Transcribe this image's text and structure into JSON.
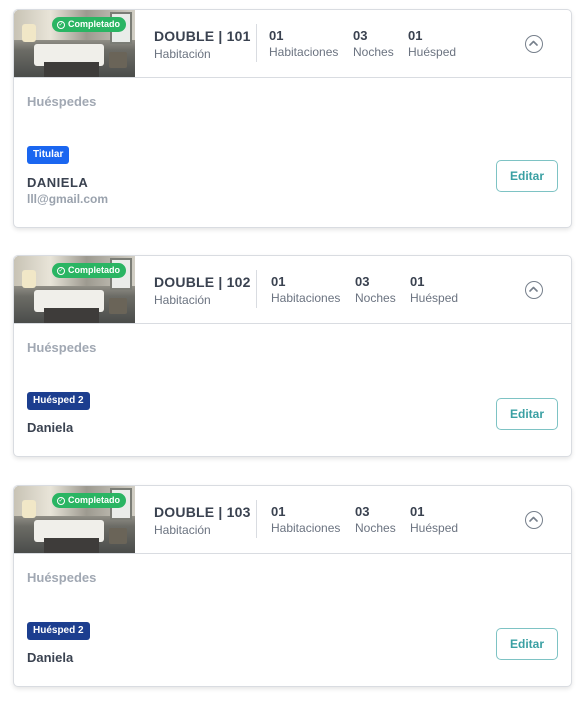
{
  "reservations": [
    {
      "status_badge": "Completado",
      "room": "DOUBLE | 101",
      "room_subtitle": "Habitación",
      "rooms_count": "01",
      "rooms_label": "Habitaciones",
      "nights_count": "03",
      "nights_label": "Noches",
      "guests_count": "01",
      "guests_label": "Huésped",
      "section_title": "Huéspedes",
      "guest_role": "Titular",
      "guest_name": "DANIELA",
      "guest_email": "lll@gmail.com",
      "edit_label": "Editar"
    },
    {
      "status_badge": "Completado",
      "room": "DOUBLE | 102",
      "room_subtitle": "Habitación",
      "rooms_count": "01",
      "rooms_label": "Habitaciones",
      "nights_count": "03",
      "nights_label": "Noches",
      "guests_count": "01",
      "guests_label": "Huésped",
      "section_title": "Huéspedes",
      "guest_role": "Huésped 2",
      "guest_name": "Daniela",
      "edit_label": "Editar"
    },
    {
      "status_badge": "Completado",
      "room": "DOUBLE | 103",
      "room_subtitle": "Habitación",
      "rooms_count": "01",
      "rooms_label": "Habitaciones",
      "nights_count": "03",
      "nights_label": "Noches",
      "guests_count": "01",
      "guests_label": "Huésped",
      "section_title": "Huéspedes",
      "guest_role": "Huésped 2",
      "guest_name": "Daniela",
      "edit_label": "Editar"
    }
  ],
  "icons": {
    "status": "check-circle-icon",
    "collapse": "chevron-up-circle-icon",
    "thumbnail": "room-photo"
  },
  "colors": {
    "completed": "#2ab563",
    "titular": "#1a66f0",
    "guest_badge": "#1c3e8f",
    "edit_accent": "#3aa0a3"
  }
}
